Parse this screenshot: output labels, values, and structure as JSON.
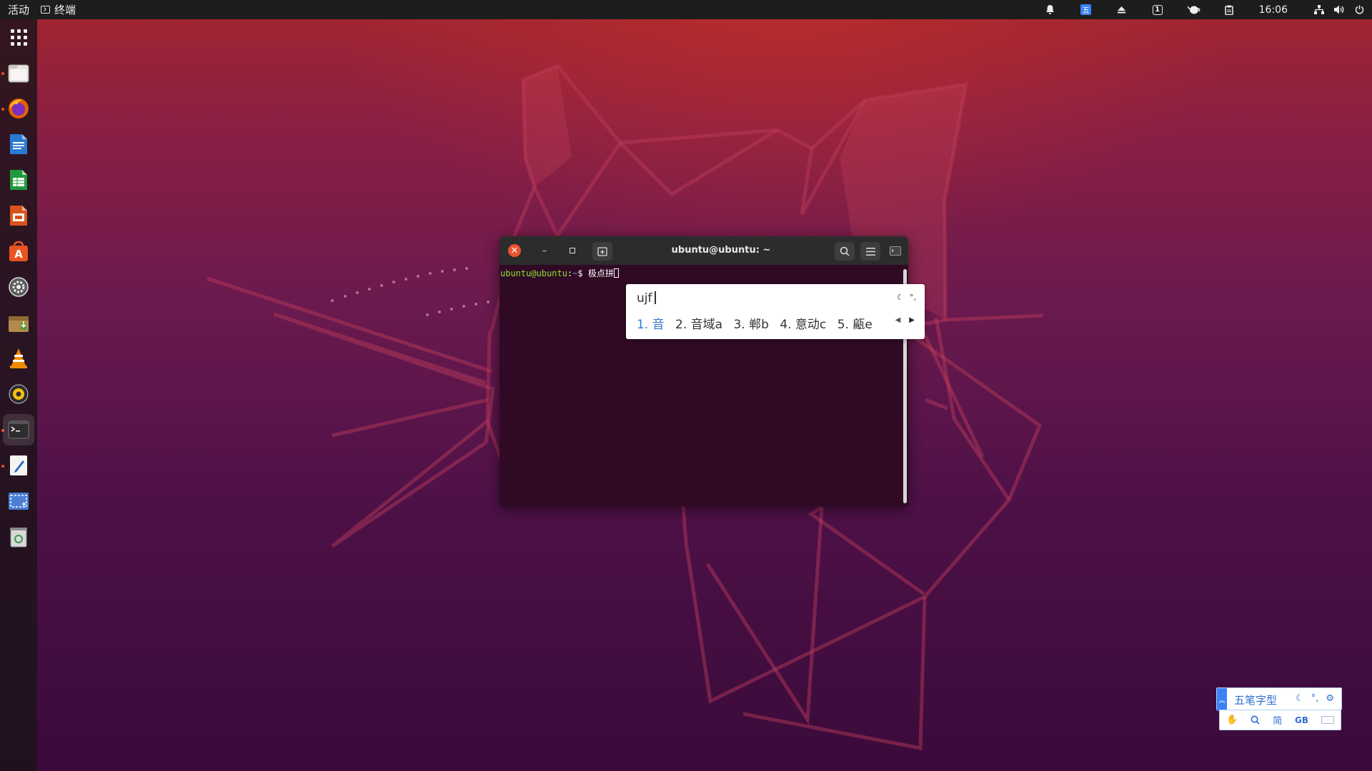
{
  "topbar": {
    "activities": "活动",
    "app_name": "终端",
    "clock": "16:06",
    "ime_badge": "五",
    "tray_one": "1",
    "icons": [
      "bell-icon",
      "ime-icon",
      "eject-icon",
      "workspace-icon",
      "teapot-icon",
      "clipboard-icon",
      "network-icon",
      "volume-icon",
      "power-icon"
    ]
  },
  "dock": {
    "items": [
      "show-apps",
      "files",
      "firefox",
      "libreoffice-writer",
      "libreoffice-calc",
      "libreoffice-impress",
      "ubuntu-software",
      "settings",
      "archive-manager",
      "vlc",
      "rhythmbox",
      "terminal",
      "text-editor",
      "screenshot",
      "trash"
    ],
    "active": "terminal"
  },
  "terminal": {
    "title": "ubuntu@ubuntu: ~",
    "prompt_user": "ubuntu@ubuntu",
    "prompt_sep": ":",
    "prompt_path": "~",
    "prompt_symbol": "$",
    "input_text": "极点拼"
  },
  "ime_popup": {
    "preedit": "ujf",
    "candidates": [
      "1. 音",
      "2. 音域a",
      "3. 郸b",
      "4. 意动c",
      "5. 甂e"
    ],
    "selected_index": 0,
    "highlight_color": "#2f7ad1"
  },
  "ime_bar": {
    "name": "五笔字型",
    "mode": "简",
    "charset": "GB",
    "accent_color": "#3b82f6"
  }
}
